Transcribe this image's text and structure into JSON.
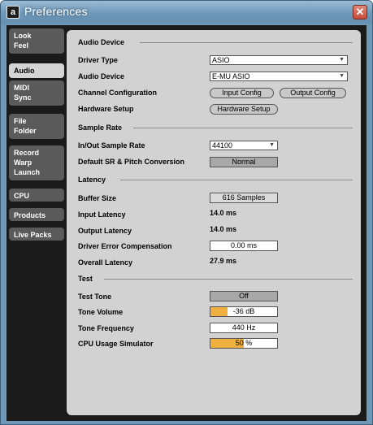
{
  "window": {
    "title": "Preferences"
  },
  "sidebar": {
    "tabs": [
      {
        "lines": [
          "Look",
          "Feel"
        ]
      },
      {
        "lines": [
          "Audio"
        ]
      },
      {
        "lines": [
          "MIDI",
          "Sync"
        ]
      },
      {
        "lines": [
          "File",
          "Folder"
        ]
      },
      {
        "lines": [
          "Record",
          "Warp",
          "Launch"
        ]
      },
      {
        "lines": [
          "CPU"
        ]
      },
      {
        "lines": [
          "Products"
        ]
      },
      {
        "lines": [
          "Live Packs"
        ]
      }
    ],
    "active": "Audio"
  },
  "audio_device": {
    "section": "Audio Device",
    "driver_type_label": "Driver Type",
    "driver_type_value": "ASIO",
    "audio_device_label": "Audio Device",
    "audio_device_value": "E-MU ASIO",
    "channel_config_label": "Channel Configuration",
    "input_config": "Input Config",
    "output_config": "Output Config",
    "hardware_setup_label": "Hardware Setup",
    "hardware_setup_button": "Hardware Setup"
  },
  "sample_rate": {
    "section": "Sample Rate",
    "in_out_label": "In/Out Sample Rate",
    "in_out_value": "44100",
    "default_sr_label": "Default SR & Pitch Conversion",
    "default_sr_value": "Normal"
  },
  "latency": {
    "section": "Latency",
    "buffer_size_label": "Buffer Size",
    "buffer_size_value": "616 Samples",
    "input_latency_label": "Input Latency",
    "input_latency_value": "14.0 ms",
    "output_latency_label": "Output Latency",
    "output_latency_value": "14.0 ms",
    "driver_error_label": "Driver Error Compensation",
    "driver_error_value": "0.00 ms",
    "overall_latency_label": "Overall Latency",
    "overall_latency_value": "27.9 ms"
  },
  "test": {
    "section": "Test",
    "test_tone_label": "Test Tone",
    "test_tone_value": "Off",
    "tone_volume_label": "Tone Volume",
    "tone_volume_value": "-36 dB",
    "tone_volume_fill": 0.25,
    "tone_frequency_label": "Tone Frequency",
    "tone_frequency_value": "440 Hz",
    "cpu_sim_label": "CPU Usage Simulator",
    "cpu_sim_value": "50 %",
    "cpu_sim_fill": 0.5
  },
  "colors": {
    "accent_fill": "#f0b040",
    "panel": "#d2d2d2",
    "frame": "#1a1a1a"
  }
}
